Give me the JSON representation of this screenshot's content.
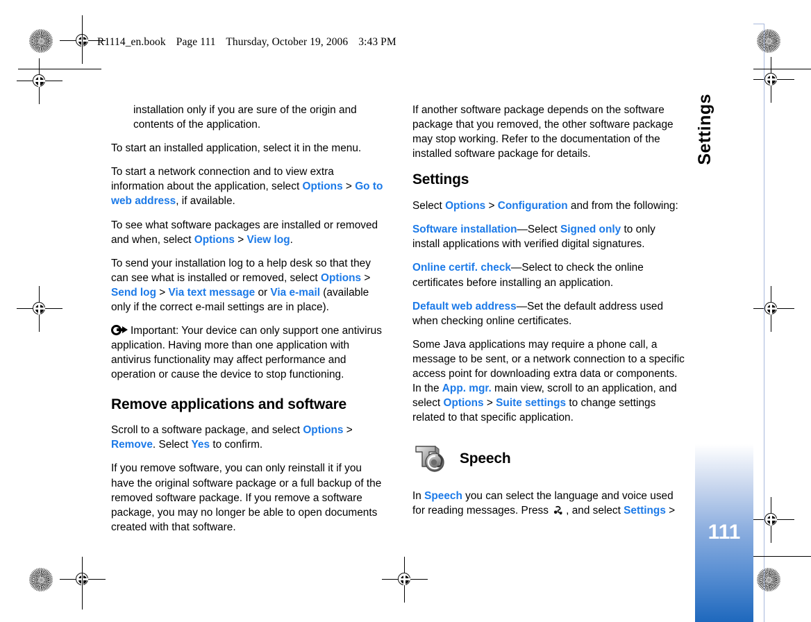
{
  "document": {
    "file_header": {
      "filename": "R1114_en.book",
      "page_label": "Page 111",
      "date": "Thursday, October 19, 2006",
      "time": "3:43 PM"
    },
    "page_number": "111",
    "sidebar_label": "Settings",
    "link_color": "#1c7ae8",
    "sidebar_gradient_top": "#ffffff",
    "sidebar_gradient_bottom": "#1e68bd"
  },
  "left_column": {
    "p1_indent": "installation only if you are sure of the origin and contents of the application.",
    "p2": "To start an installed application, select it in the menu.",
    "p3": {
      "t1": "To start a network connection and to view extra information about the application, select ",
      "ui1": "Options",
      "sep1": " > ",
      "ui2": "Go to web address",
      "t2": ", if available."
    },
    "p4": {
      "t1": "To see what software packages are installed or removed and when, select ",
      "ui1": "Options",
      "sep1": " > ",
      "ui2": "View log",
      "t2": "."
    },
    "p5": {
      "t1": "To send your installation log to a help desk so that they can see what is installed or removed, select ",
      "ui1": "Options",
      "sep1": " > ",
      "ui2": "Send log",
      "sep2": " > ",
      "ui3": "Via text message",
      "t2": " or ",
      "ui4": "Via e-mail",
      "t3": " (available only if the correct e-mail settings are in place)."
    },
    "note": {
      "icon": "important-note-icon",
      "text": "Important: Your device can only support one antivirus application. Having more than one application with antivirus functionality may affect performance and operation or cause the device to stop functioning."
    },
    "heading_remove": "Remove applications and software",
    "p6": {
      "t1": "Scroll to a software package, and select ",
      "ui1": "Options",
      "sep1": " > ",
      "ui2": "Remove",
      "t2": ". Select ",
      "ui3": "Yes",
      "t3": " to confirm."
    },
    "p7": "If you remove software, you can only reinstall it if you have the original software package or a full backup of the removed software package. If you remove a software package, you may no longer be able to open documents created with that software."
  },
  "right_column": {
    "p1": "If another software package depends on the software package that you removed, the other software package may stop working. Refer to the documentation of the installed software package for details.",
    "heading_settings": "Settings",
    "p2": {
      "t1": "Select ",
      "ui1": "Options",
      "sep1": " > ",
      "ui2": "Configuration",
      "t2": " and from the following:"
    },
    "item1": {
      "ui1": "Software installation",
      "t1": "—Select ",
      "ui2": "Signed only",
      "t2": " to only install applications with verified digital signatures."
    },
    "item2": {
      "ui1": "Online certif. check",
      "t1": "—Select to check the online certificates before installing an application."
    },
    "item3": {
      "ui1": "Default web address",
      "t1": "—Set the default address used when checking online certificates."
    },
    "p3": {
      "t1": "Some Java applications may require a phone call, a message to be sent, or a network connection to a specific access point for downloading extra data or components. In the ",
      "ui1": "App. mgr.",
      "t2": " main view, scroll to an application, and select ",
      "ui2": "Options",
      "sep1": " > ",
      "ui3": "Suite settings",
      "t3": " to change settings related to that specific application."
    },
    "speech": {
      "icon": "speech-app-icon",
      "heading": "Speech",
      "body": {
        "t1": "In ",
        "ui1": "Speech",
        "t2": " you can select the language and voice used for reading messages. Press ",
        "key_icon": "menu-key-icon",
        "t3": ", and select ",
        "ui2": "Settings",
        "sep1": " >"
      }
    }
  }
}
